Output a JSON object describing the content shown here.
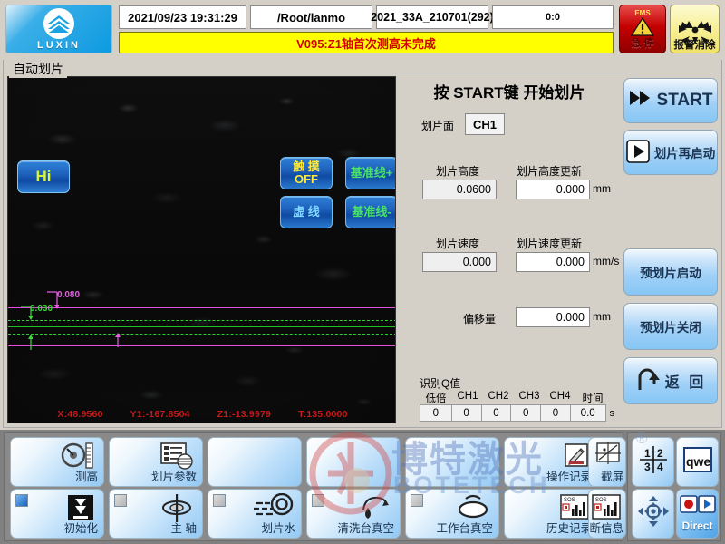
{
  "header": {
    "logo_text": "LUXIN",
    "datetime": "2021/09/23 19:31:29",
    "path": "/Root/lanmo",
    "recipe": "2021_33A_210701(292)",
    "counter": "0:0",
    "alarm_message": "V095:Z1轴首次测高未完成",
    "ems": {
      "top_label": "EMS",
      "cn_label": "急 停"
    },
    "alarm_clear_label": "报警消除",
    "colors": {
      "alarm_bar_bg": "#ffff00",
      "alarm_text": "#d00000",
      "ems_bg": "#c40000",
      "clear_bg": "#f7ef96"
    }
  },
  "groupbox": {
    "title": "自动划片"
  },
  "video": {
    "hi_button": "Hi",
    "overlay_buttons": [
      {
        "name": "touch",
        "line1": "触 摸",
        "line2": "OFF",
        "color": "#ffe93b"
      },
      {
        "name": "dashed",
        "line1": "虚 线",
        "line2": "",
        "color": "#7fd8ff"
      },
      {
        "name": "refline-plus",
        "line1": "基准线+",
        "line2": "",
        "color": "#49e26a"
      },
      {
        "name": "refline-minus",
        "line1": "基准线-",
        "line2": "",
        "color": "#49e26a"
      }
    ],
    "measure_labels": {
      "magenta": "0.080",
      "green": "0.030"
    },
    "coords": [
      {
        "axis": "X",
        "value": "48.9560",
        "text": "X:48.9560"
      },
      {
        "axis": "Y1",
        "value": "-167.8504",
        "text": "Y1:-167.8504"
      },
      {
        "axis": "Z1",
        "value": "-13.9979",
        "text": "Z1:-13.9979"
      },
      {
        "axis": "T",
        "value": "135.0000",
        "text": "T:135.0000"
      }
    ]
  },
  "center": {
    "title": "按 START键 开始划片",
    "dice_face_label": "划片面",
    "dice_face_value": "CH1",
    "height_label": "划片高度",
    "height_value": "0.0600",
    "height_update_label": "划片高度更新",
    "height_update_value": "0.000",
    "height_unit": "mm",
    "speed_label": "划片速度",
    "speed_value": "0.000",
    "speed_update_label": "划片速度更新",
    "speed_update_value": "0.000",
    "speed_unit": "mm/s",
    "offset_label": "偏移量",
    "offset_value": "0.000",
    "offset_unit": "mm",
    "qvalue": {
      "title": "识别Q值",
      "headers": [
        "低倍",
        "CH1",
        "CH2",
        "CH3",
        "CH4",
        "时间"
      ],
      "values": [
        "0",
        "0",
        "0",
        "0",
        "0",
        "0.0"
      ],
      "time_unit": "s"
    }
  },
  "right_buttons": [
    {
      "name": "start",
      "label": "START",
      "icon": "double-chevron-right-icon"
    },
    {
      "name": "dice-restart",
      "label": "划片再启动",
      "icon": "play-box-icon"
    },
    {
      "name": "pre-dice-start",
      "label": "预划片启动",
      "icon": ""
    },
    {
      "name": "pre-dice-stop",
      "label": "预划片关闭",
      "icon": ""
    },
    {
      "name": "back",
      "label": "返 回",
      "icon": "uturn-arrow-icon"
    }
  ],
  "toolbar": {
    "row1": [
      {
        "name": "height-measure",
        "label": "测高",
        "icon": "dial-gauge-icon",
        "indicator": null
      },
      {
        "name": "dice-parameters",
        "label": "划片参数",
        "icon": "document-list-icon",
        "indicator": null
      },
      {
        "name": "blank-1",
        "label": "",
        "icon": "",
        "indicator": null
      },
      {
        "name": "blank-2",
        "label": "",
        "icon": "",
        "indicator": null
      },
      {
        "name": "blank-3",
        "label": "",
        "icon": "",
        "indicator": null
      },
      {
        "name": "operation-log",
        "label": "操作记录",
        "icon": "pencil-note-icon",
        "indicator": null
      },
      {
        "name": "screenshot",
        "label": "截屏",
        "icon": "chart-capture-icon",
        "indicator": null
      }
    ],
    "row2": [
      {
        "name": "initialize",
        "label": "初始化",
        "icon": "down-arrow-block-icon",
        "indicator": "on"
      },
      {
        "name": "spindle",
        "label": "主 轴",
        "icon": "spindle-icon",
        "indicator": "off"
      },
      {
        "name": "dice-water",
        "label": "划片水",
        "icon": "water-nozzle-icon",
        "indicator": "off"
      },
      {
        "name": "clean-table-vacuum",
        "label": "清洗台真空",
        "icon": "vacuum-icon",
        "indicator": "off"
      },
      {
        "name": "work-table-vacuum",
        "label": "工作台真空",
        "icon": "table-vacuum-icon",
        "indicator": "off"
      },
      {
        "name": "history-log",
        "label": "历史记录",
        "icon": "bar-chart-sos-icon",
        "indicator": null
      },
      {
        "name": "diagnostic-info",
        "label": "诊断信息",
        "icon": "bar-chart-sos-icon",
        "indicator": null
      }
    ],
    "right_pad": [
      {
        "name": "quadrant",
        "label": "",
        "icon": "quadrant-1234-icon",
        "selected": false
      },
      {
        "name": "keyboard",
        "label": "",
        "icon": "qwe-keyboard-icon",
        "selected": false
      },
      {
        "name": "jog-pad",
        "label": "",
        "icon": "dpad-icon",
        "selected": false
      },
      {
        "name": "direct",
        "label": "Direct",
        "icon": "record-play-icon",
        "selected": true
      }
    ]
  },
  "watermark": {
    "cn": "博特激光",
    "en": "BOTETECH",
    "registered": "®"
  }
}
